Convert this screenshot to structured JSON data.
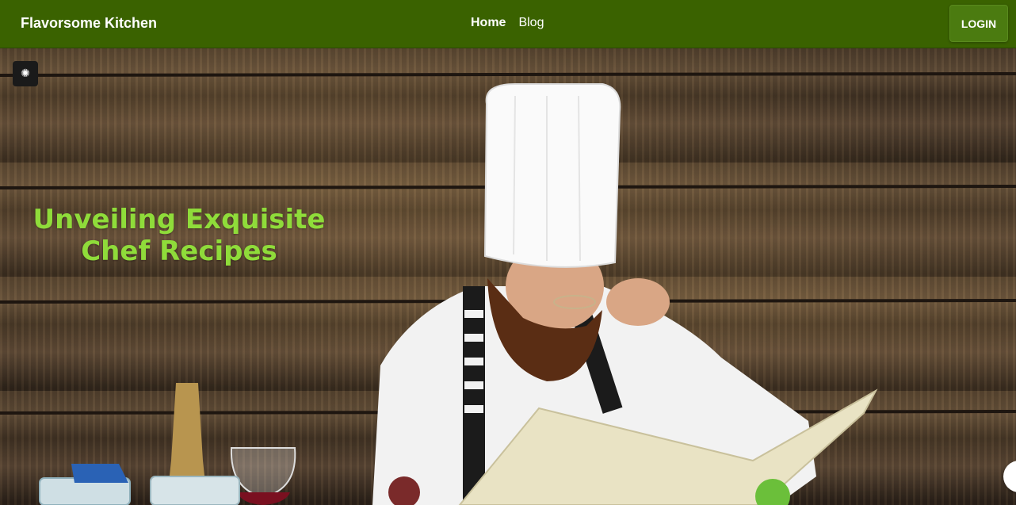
{
  "navbar": {
    "brand": "Flavorsome Kitchen",
    "links": [
      {
        "label": "Home",
        "active": true
      },
      {
        "label": "Blog",
        "active": false
      }
    ],
    "login_label": "LOGIN"
  },
  "hero": {
    "title_line1": "Unveiling Exquisite",
    "title_line2": "Chef Recipes",
    "badge_icon": "brain-icon"
  },
  "colors": {
    "navbar": "#3a6200",
    "accent_text": "#8fdc3a"
  }
}
